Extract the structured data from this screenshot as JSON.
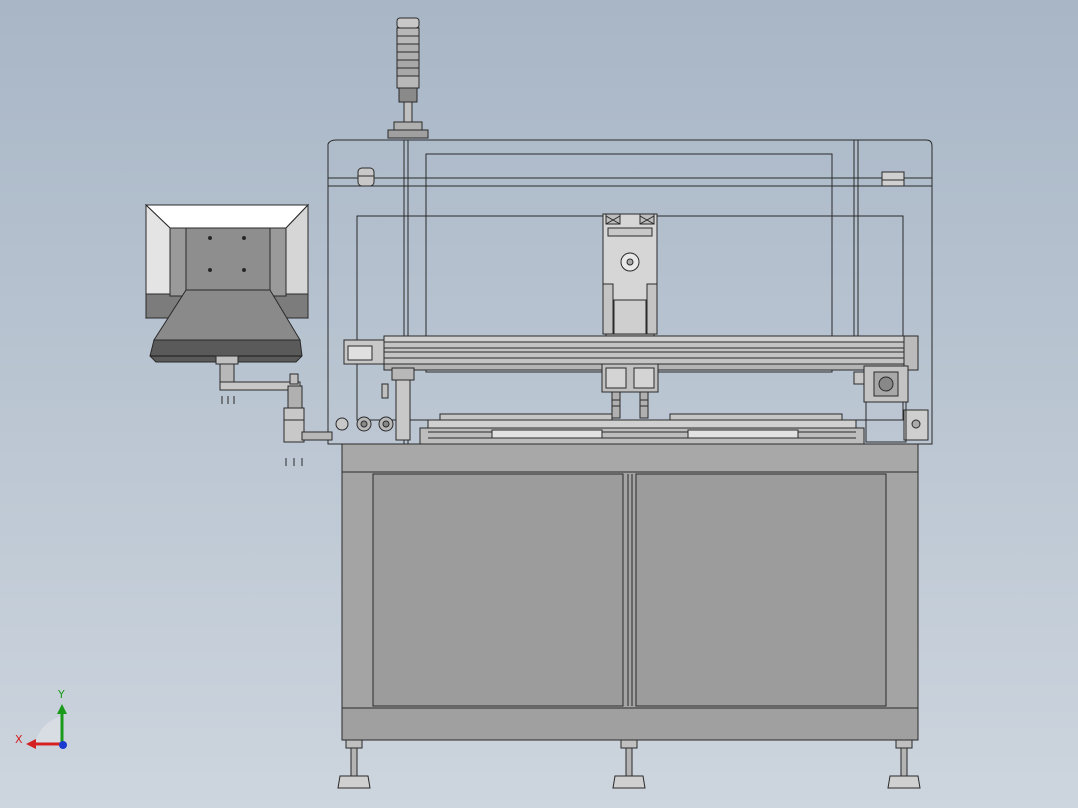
{
  "viewport": {
    "background_top": "#a8b6c6",
    "background_bottom": "#cdd5de"
  },
  "triad": {
    "x_label": "X",
    "y_label": "Y",
    "x_color": "#d42020",
    "y_color": "#1a9a1a",
    "z_color": "#1a3ad0"
  },
  "model": {
    "line_color": "#2a2a2a",
    "body_gray": "#a0a0a0",
    "panel_gray": "#9a9a9a",
    "frame_gray": "#b4b4b4",
    "monitor_dark": "#5a5a5a",
    "monitor_light": "#e6e6e6",
    "glass": "transparent",
    "components": [
      "signal-tower",
      "enclosure-cover",
      "monitor",
      "monitor-arm",
      "gantry-beam",
      "z-axis-head",
      "work-table",
      "base-cabinet",
      "cabinet-door-left",
      "cabinet-door-right",
      "leveling-feet",
      "servo-motor"
    ]
  }
}
